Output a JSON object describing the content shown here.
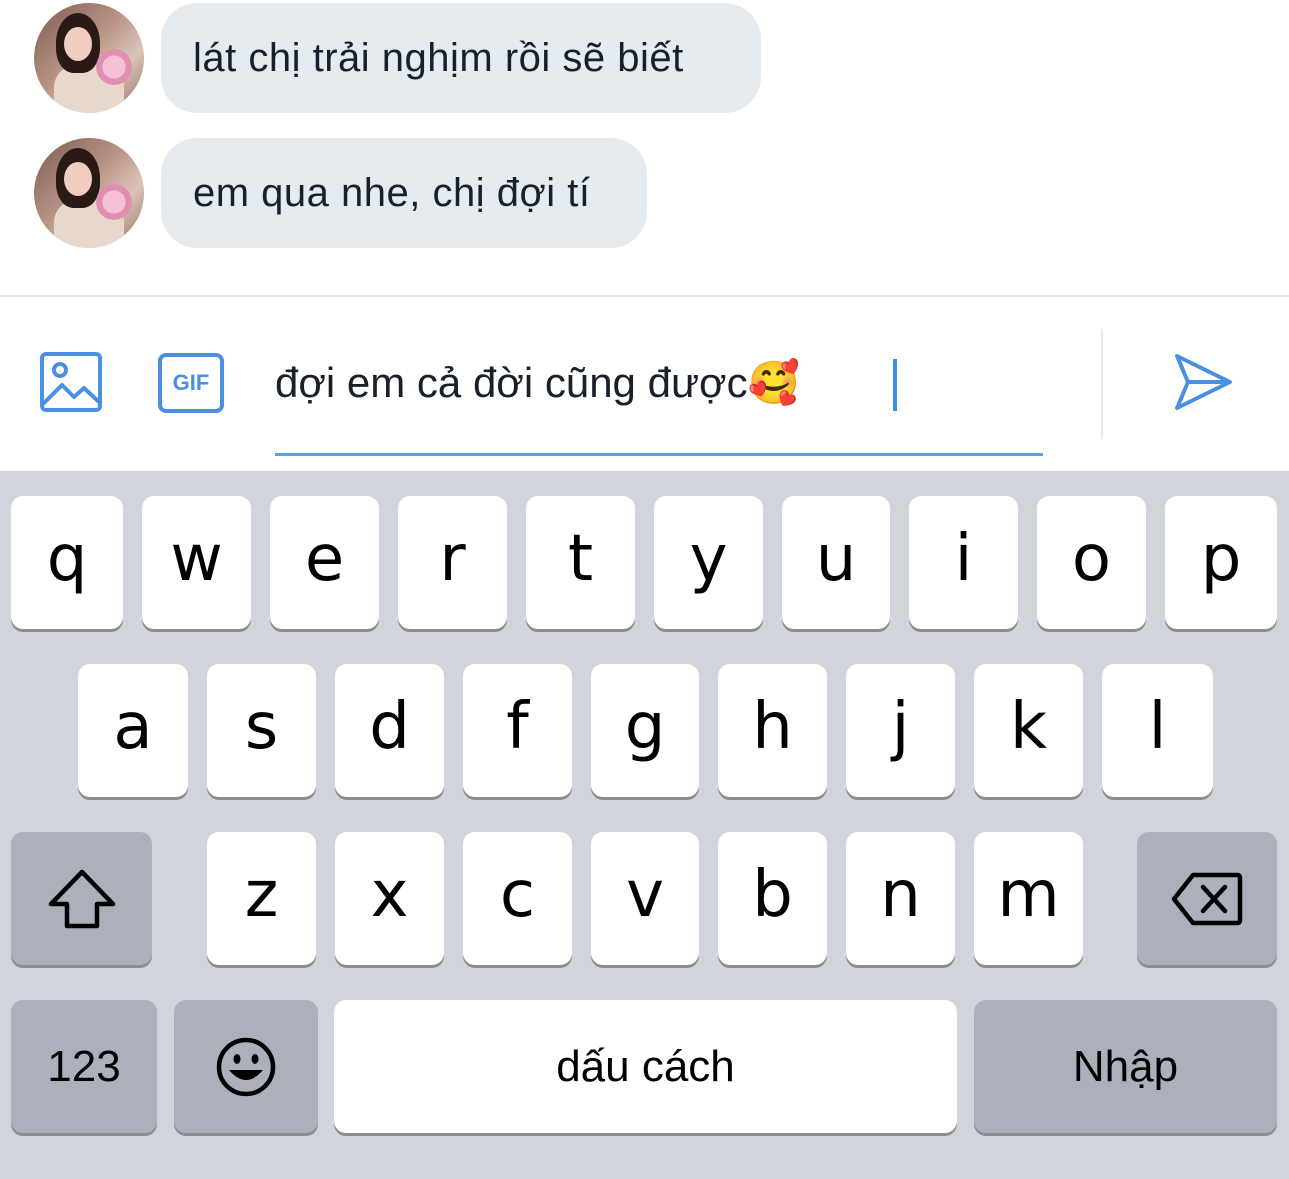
{
  "messages": [
    {
      "text": "lát chị trải nghịm rồi sẽ biết"
    },
    {
      "text": "em qua nhe, chị đợi tí"
    }
  ],
  "composer": {
    "image_icon": "image-icon",
    "gif_label": "GIF",
    "input_value": "đợi em cả đời cũng được🥰",
    "send_icon": "send-icon",
    "accent_color": "#4a90e2"
  },
  "keyboard": {
    "row1": [
      "q",
      "w",
      "e",
      "r",
      "t",
      "y",
      "u",
      "i",
      "o",
      "p"
    ],
    "row2": [
      "a",
      "s",
      "d",
      "f",
      "g",
      "h",
      "j",
      "k",
      "l"
    ],
    "row3": [
      "z",
      "x",
      "c",
      "v",
      "b",
      "n",
      "m"
    ],
    "shift_icon": "shift-icon",
    "backspace_icon": "backspace-icon",
    "numbers_label": "123",
    "emoji_icon": "emoji-icon",
    "space_label": "dấu cách",
    "return_label": "Nhập"
  }
}
